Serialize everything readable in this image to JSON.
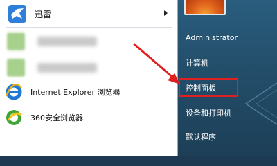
{
  "left_panel": {
    "pinned": {
      "label": "迅雷"
    },
    "items": [
      {
        "label": "Internet Explorer 浏览器"
      },
      {
        "label": "360安全浏览器"
      }
    ]
  },
  "right_panel": {
    "user": "Administrator",
    "items": [
      {
        "label": "计算机"
      },
      {
        "label": "控制面板"
      },
      {
        "label": "设备和打印机"
      },
      {
        "label": "默认程序"
      }
    ]
  },
  "colors": {
    "highlight": "#e02020",
    "right_panel": "#234e6a"
  }
}
